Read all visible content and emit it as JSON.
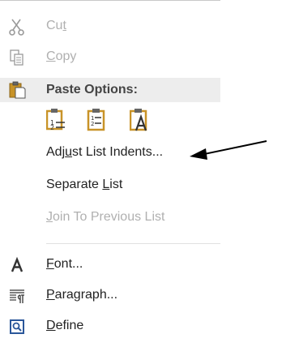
{
  "menu": {
    "items": [
      {
        "id": "cut",
        "before": "Cu",
        "key": "t",
        "after": "",
        "icon": "scissors-icon",
        "disabled": true
      },
      {
        "id": "copy",
        "before": "",
        "key": "C",
        "after": "opy",
        "icon": "copy-icon",
        "disabled": true
      },
      {
        "id": "paste-options",
        "before": "Paste Options:",
        "key": "",
        "after": "",
        "icon": "clipboard-icon",
        "header": true
      },
      {
        "id": "adjust-list-indents",
        "before": "Adj",
        "key": "u",
        "after": "st List Indents...",
        "icon": "",
        "disabled": false
      },
      {
        "id": "separate-list",
        "before": "Separate ",
        "key": "L",
        "after": "ist",
        "icon": "",
        "disabled": false
      },
      {
        "id": "join-to-previous-list",
        "before": "",
        "key": "J",
        "after": "oin To Previous List",
        "icon": "",
        "disabled": true
      },
      {
        "id": "font",
        "before": "",
        "key": "F",
        "after": "ont...",
        "icon": "font-A-icon",
        "disabled": false
      },
      {
        "id": "paragraph",
        "before": "",
        "key": "P",
        "after": "aragraph...",
        "icon": "paragraph-icon",
        "disabled": false
      },
      {
        "id": "define",
        "before": "",
        "key": "D",
        "after": "efine",
        "icon": "define-icon",
        "disabled": false
      }
    ],
    "paste_buttons": [
      {
        "id": "paste-continue-list",
        "icon": "paste-continue-list-icon"
      },
      {
        "id": "paste-new-list",
        "icon": "paste-new-list-icon"
      },
      {
        "id": "paste-keep-text-only",
        "icon": "paste-text-only-icon"
      }
    ]
  },
  "colors": {
    "accent_blue": "#2b579a",
    "clipboard_gold": "#c89328",
    "header_bg": "#ededed",
    "disabled_text": "#b0b0b0",
    "text": "#222222"
  }
}
